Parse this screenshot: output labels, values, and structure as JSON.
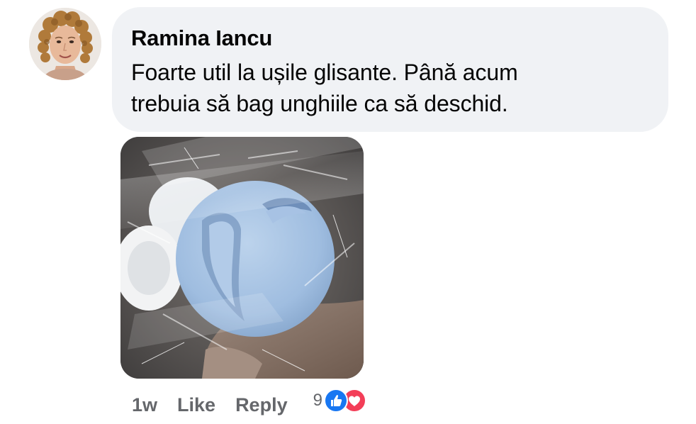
{
  "comment": {
    "author": "Ramina Iancu",
    "text": "Foarte util la ușile glisante. Până acum\ntrebuia să bag unghiile ca să deschid.",
    "time": "1w",
    "like_label": "Like",
    "reply_label": "Reply",
    "reaction_count": "9",
    "reaction_icons": [
      "like-icon",
      "love-icon"
    ]
  },
  "colors": {
    "bubble_bg": "#f0f2f5",
    "meta_text": "#65676b",
    "like_blue": "#1877f2",
    "love_red": "#f33e58"
  }
}
